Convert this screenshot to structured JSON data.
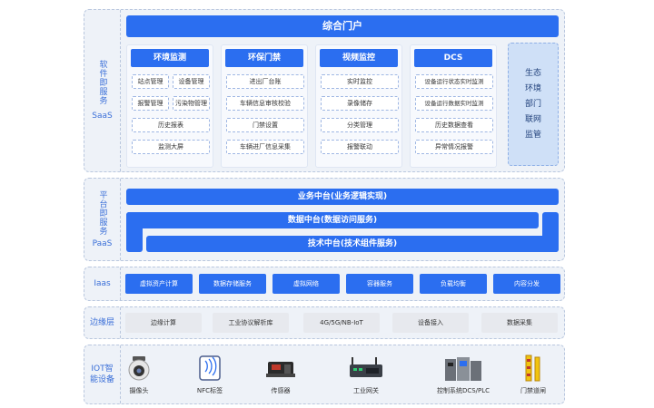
{
  "saas": {
    "label_main": "软件即服务",
    "label_sub": "SaaS",
    "portal": "综合门户",
    "columns": [
      {
        "title": "环境监测",
        "rows": [
          [
            "站点管理",
            "设备管理"
          ],
          [
            "报警管理",
            "污染物管理"
          ],
          [
            "历史报表"
          ],
          [
            "监测大屏"
          ]
        ]
      },
      {
        "title": "环保门禁",
        "rows": [
          [
            "进出厂台账"
          ],
          [
            "车辆信息审核校验"
          ],
          [
            "门禁设置"
          ],
          [
            "车辆进厂信息采集"
          ]
        ]
      },
      {
        "title": "视频监控",
        "rows": [
          [
            "实时监控"
          ],
          [
            "录像储存"
          ],
          [
            "分类管理"
          ],
          [
            "报警联动"
          ]
        ]
      },
      {
        "title": "DCS",
        "rows": [
          [
            "设备运行状态实时监测"
          ],
          [
            "设备运行数据实时监测"
          ],
          [
            "历史数据查看"
          ],
          [
            "异常情况报警"
          ]
        ]
      }
    ],
    "side": [
      "生态",
      "环境",
      "部门",
      "联网",
      "监管"
    ]
  },
  "paas": {
    "label_main": "平台即服务",
    "label_sub": "PaaS",
    "bars": [
      "业务中台(业务逻辑实现)",
      "数据中台(数据访问服务)",
      "技术中台(技术组件服务)"
    ]
  },
  "iaas": {
    "label": "Iaas",
    "items": [
      "虚拟资产计算",
      "数据存储服务",
      "虚拟网络",
      "容器服务",
      "负载均衡",
      "内容分发"
    ]
  },
  "edge": {
    "label": "边缘层",
    "items": [
      "边缘计算",
      "工业协议解析库",
      "4G/5G/NB-IoT",
      "设备接入",
      "数据采集"
    ]
  },
  "iot": {
    "label": "IOT智能设备",
    "devices": [
      {
        "name": "摄像头",
        "icon": "camera-icon"
      },
      {
        "name": "NFC标签",
        "icon": "nfc-tag-icon"
      },
      {
        "name": "传感器",
        "icon": "sensor-icon"
      },
      {
        "name": "工业网关",
        "icon": "gateway-icon"
      },
      {
        "name": "控制系统DCS/PLC",
        "icon": "control-cabinet-icon"
      },
      {
        "name": "门禁道闸",
        "icon": "barrier-gate-icon"
      }
    ]
  },
  "colors": {
    "accent": "#2b6ef0",
    "panel": "#eef2f8",
    "label": "#3a6fd8"
  }
}
